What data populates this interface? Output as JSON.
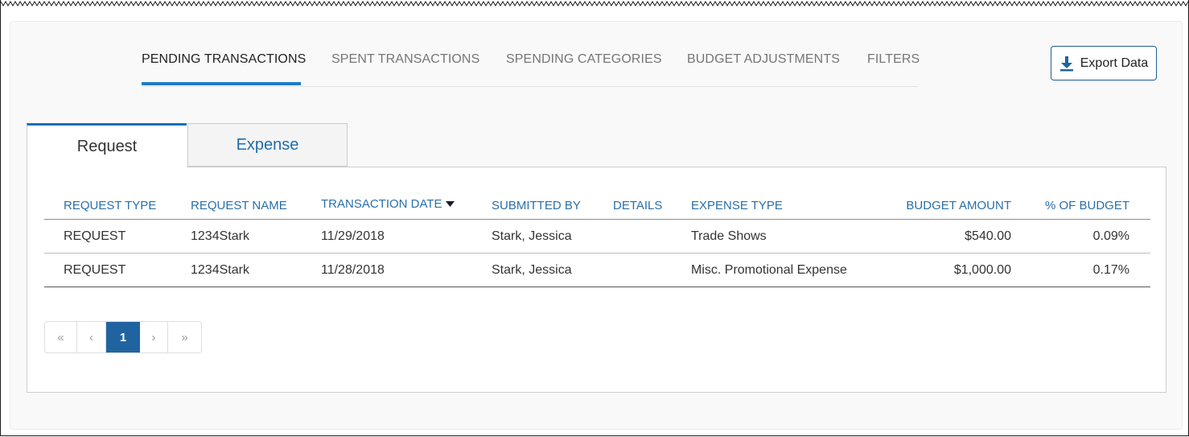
{
  "nav": {
    "tabs": [
      {
        "label": "PENDING TRANSACTIONS",
        "active": true
      },
      {
        "label": "SPENT TRANSACTIONS",
        "active": false
      },
      {
        "label": "SPENDING CATEGORIES",
        "active": false
      },
      {
        "label": "BUDGET ADJUSTMENTS",
        "active": false
      },
      {
        "label": "FILTERS",
        "active": false
      }
    ],
    "accent_color": "#1c7cc7"
  },
  "export": {
    "label": "Export Data",
    "icon": "download-icon"
  },
  "subtabs": [
    {
      "label": "Request",
      "active": true
    },
    {
      "label": "Expense",
      "active": false
    }
  ],
  "table": {
    "columns": [
      "REQUEST TYPE",
      "REQUEST NAME",
      "TRANSACTION DATE",
      "SUBMITTED BY",
      "DETAILS",
      "EXPENSE TYPE",
      "BUDGET AMOUNT",
      "% OF BUDGET"
    ],
    "sort_icon": "caret-down-icon",
    "rows": [
      [
        "REQUEST",
        "1234Stark",
        "11/29/2018",
        "Stark, Jessica",
        "",
        "Trade Shows",
        "$540.00",
        "0.09%"
      ],
      [
        "REQUEST",
        "1234Stark",
        "11/28/2018",
        "Stark, Jessica",
        "",
        "Misc. Promotional Expense",
        "$1,000.00",
        "0.17%"
      ]
    ]
  },
  "pagination": {
    "first": "«",
    "prev": "‹",
    "current": "1",
    "next": "›",
    "last": "»",
    "active_color": "#1f64a0"
  }
}
